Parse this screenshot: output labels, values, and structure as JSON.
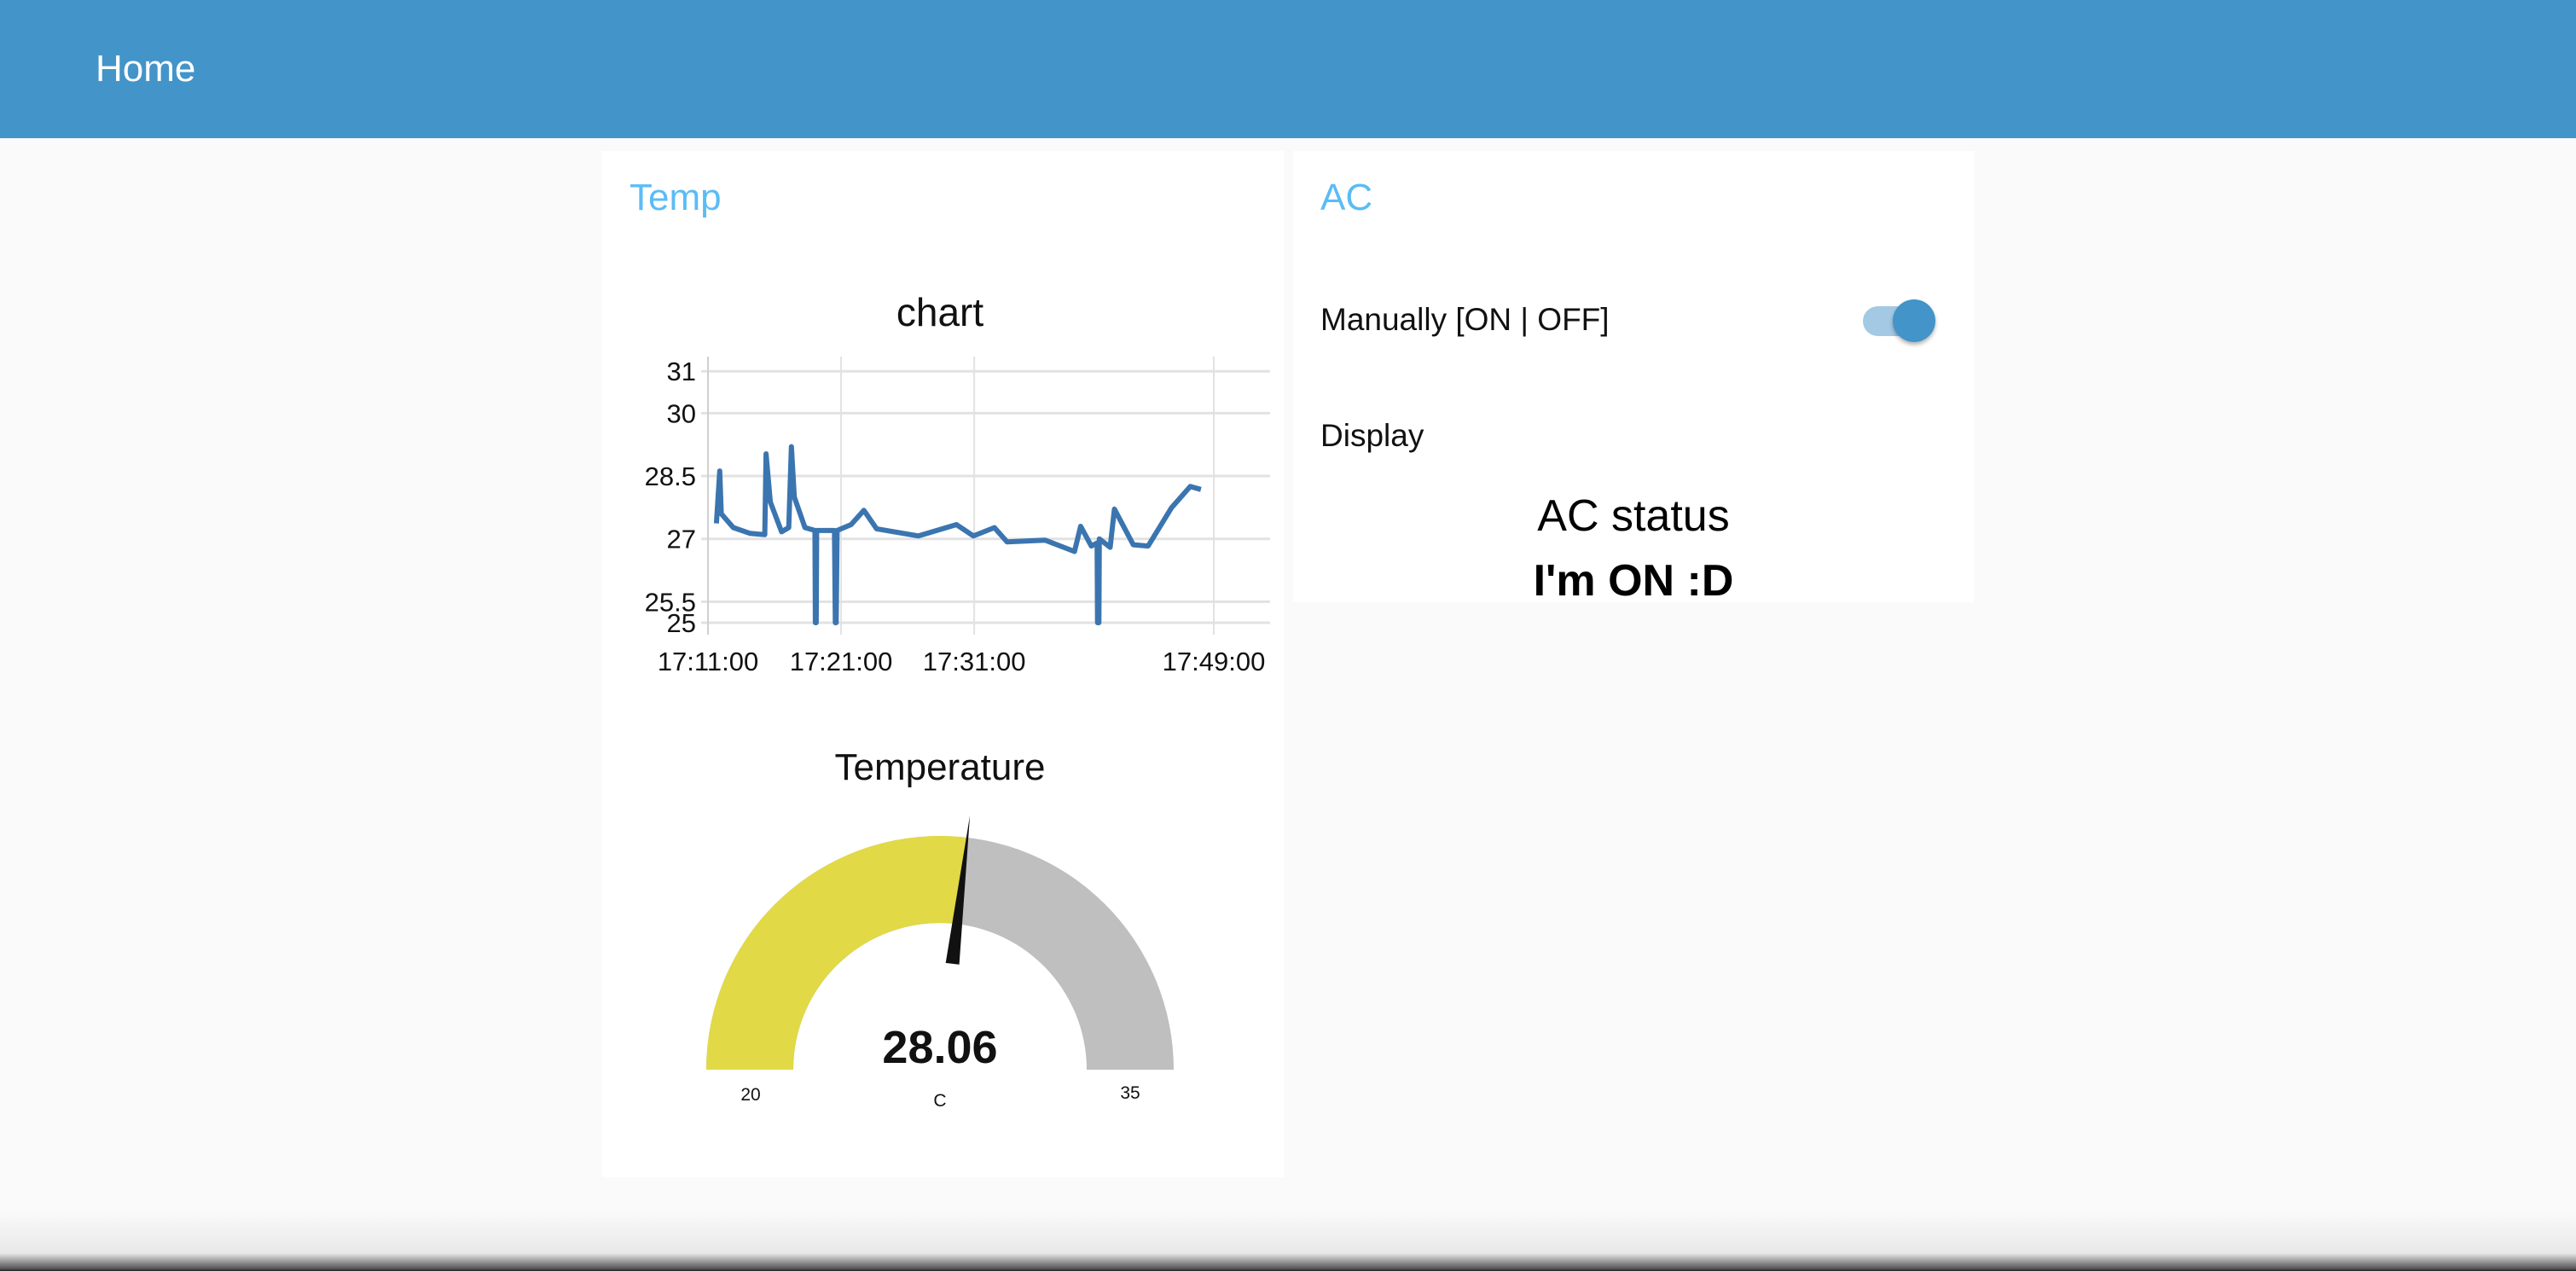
{
  "header": {
    "title": "Home"
  },
  "temp_group": {
    "title": "Temp",
    "chart": {
      "title": "chart"
    },
    "gauge": {
      "title": "Temperature",
      "value": 28.06,
      "value_label": "28.06",
      "units": "C",
      "min": 20,
      "max": 35,
      "min_label": "20",
      "max_label": "35",
      "fill_color": "#e1d946",
      "track_color": "#bfbfbf"
    }
  },
  "ac_group": {
    "title": "AC",
    "switch_label": "Manually [ON | OFF]",
    "switch_on": true,
    "display_label": "Display",
    "status_title": "AC status",
    "status_value": "I'm ON :D"
  },
  "colors": {
    "header": "#4394c9",
    "group_title": "#5bbcf5",
    "series": "#3b75b0"
  },
  "chart_data": {
    "type": "line",
    "title": "chart",
    "xlabel": "",
    "ylabel": "",
    "xlim": [
      "17:11:00",
      "17:49:00"
    ],
    "ylim": [
      25,
      31.35
    ],
    "x_ticks": [
      "17:11:00",
      "17:21:00",
      "17:31:00",
      "17:49:00"
    ],
    "y_ticks": [
      31,
      30,
      28.5,
      27,
      25.5,
      25
    ],
    "y_tick_labels": [
      "31",
      "30",
      "28.5",
      "27",
      "25.5",
      "25"
    ],
    "grid": true,
    "series": [
      {
        "color": "#3b75b0",
        "points": [
          [
            "17:11:38",
            27.37
          ],
          [
            "17:11:53",
            28.62
          ],
          [
            "17:12:00",
            27.6
          ],
          [
            "17:12:54",
            27.27
          ],
          [
            "17:14:10",
            27.13
          ],
          [
            "17:15:16",
            27.1
          ],
          [
            "17:15:22",
            29.03
          ],
          [
            "17:15:41",
            27.88
          ],
          [
            "17:16:32",
            27.17
          ],
          [
            "17:17:04",
            27.27
          ],
          [
            "17:17:16",
            29.2
          ],
          [
            "17:17:29",
            28.0
          ],
          [
            "17:18:17",
            27.27
          ],
          [
            "17:19:02",
            27.2
          ],
          [
            "17:19:04",
            25
          ],
          [
            "17:19:08",
            25
          ],
          [
            "17:19:10",
            27.2
          ],
          [
            "17:20:30",
            27.2
          ],
          [
            "17:20:34",
            25
          ],
          [
            "17:20:38",
            25
          ],
          [
            "17:20:42",
            27.2
          ],
          [
            "17:21:45",
            27.34
          ],
          [
            "17:22:43",
            27.68
          ],
          [
            "17:23:40",
            27.24
          ],
          [
            "17:26:49",
            27.07
          ],
          [
            "17:29:40",
            27.34
          ],
          [
            "17:30:56",
            27.07
          ],
          [
            "17:32:31",
            27.27
          ],
          [
            "17:33:28",
            26.93
          ],
          [
            "17:36:19",
            26.97
          ],
          [
            "17:38:32",
            26.7
          ],
          [
            "17:39:00",
            27.3
          ],
          [
            "17:39:48",
            26.83
          ],
          [
            "17:40:14",
            26.9
          ],
          [
            "17:40:16",
            25
          ],
          [
            "17:40:22",
            25
          ],
          [
            "17:40:24",
            27.0
          ],
          [
            "17:41:13",
            26.8
          ],
          [
            "17:41:32",
            27.71
          ],
          [
            "17:42:57",
            26.86
          ],
          [
            "17:44:04",
            26.83
          ],
          [
            "17:45:49",
            27.74
          ],
          [
            "17:47:14",
            28.25
          ],
          [
            "17:48:02",
            28.18
          ]
        ]
      }
    ]
  }
}
